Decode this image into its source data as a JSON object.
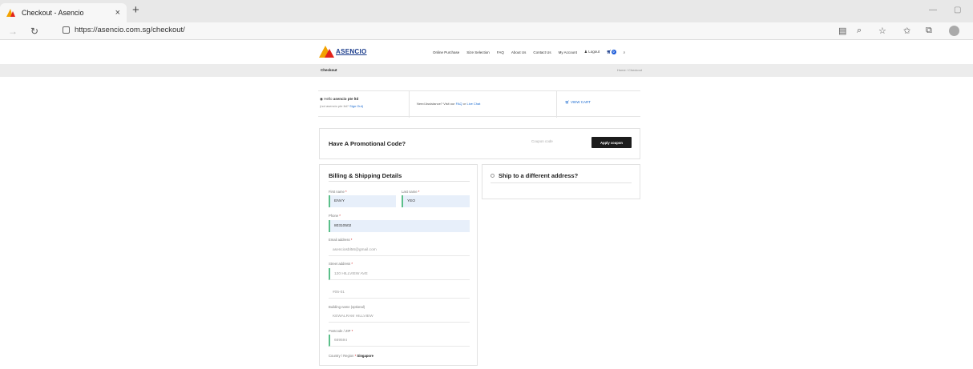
{
  "browser": {
    "tab_title": "Checkout - Asencio",
    "tab_close": "×",
    "new_tab": "+",
    "url": "https://asencio.com.sg/checkout/"
  },
  "site": {
    "logo_text": "ASENCIO",
    "menu": [
      "Online Purchase",
      "Size Selection",
      "FAQ",
      "About Us",
      "Contact Us",
      "My Account",
      "Logout"
    ],
    "cart_count": "0",
    "page_title": "Checkout",
    "breadcrumb": "Home / Checkout"
  },
  "info": {
    "hello_prefix": "Hello",
    "user_name": "asencio pte ltd",
    "not_user": "(not asencio pte ltd?",
    "sign_out": "Sign Out)",
    "assist_text": "Need Assistance? Visit our",
    "faq_link": "FAQ",
    "or_text": "or",
    "live_chat": "Live Chat",
    "view_cart": "VIEW CART"
  },
  "promo": {
    "title": "Have A Promotional Code?",
    "coupon_placeholder": "Coupon code",
    "apply_label": "Apply coupon"
  },
  "billing": {
    "title": "Billing & Shipping Details",
    "first_name_label": "First name",
    "first_name": "ENVY",
    "last_name_label": "Last name",
    "last_name": "YEO",
    "phone_label": "Phone",
    "phone": "80310502",
    "email_label": "Email address",
    "email": "asenciosbl56@gmail.com",
    "street_label": "Street address",
    "street1": "120 HILLVIEW AVE",
    "street2": "#05-01",
    "building_label": "Building name (optional)",
    "building": "KEWALRAM HILLVIEW",
    "postcode_label": "Postcode / ZIP",
    "postcode": "669594",
    "country_label": "Country / Region",
    "country": "Singapore",
    "required_mark": "*"
  },
  "shipping": {
    "title": "Ship to a different address?"
  },
  "colors": {
    "accent": "#1a3c8c",
    "field_fill": "#e7effa",
    "field_bar": "#5bbf8a",
    "button": "#1c1c1c"
  }
}
